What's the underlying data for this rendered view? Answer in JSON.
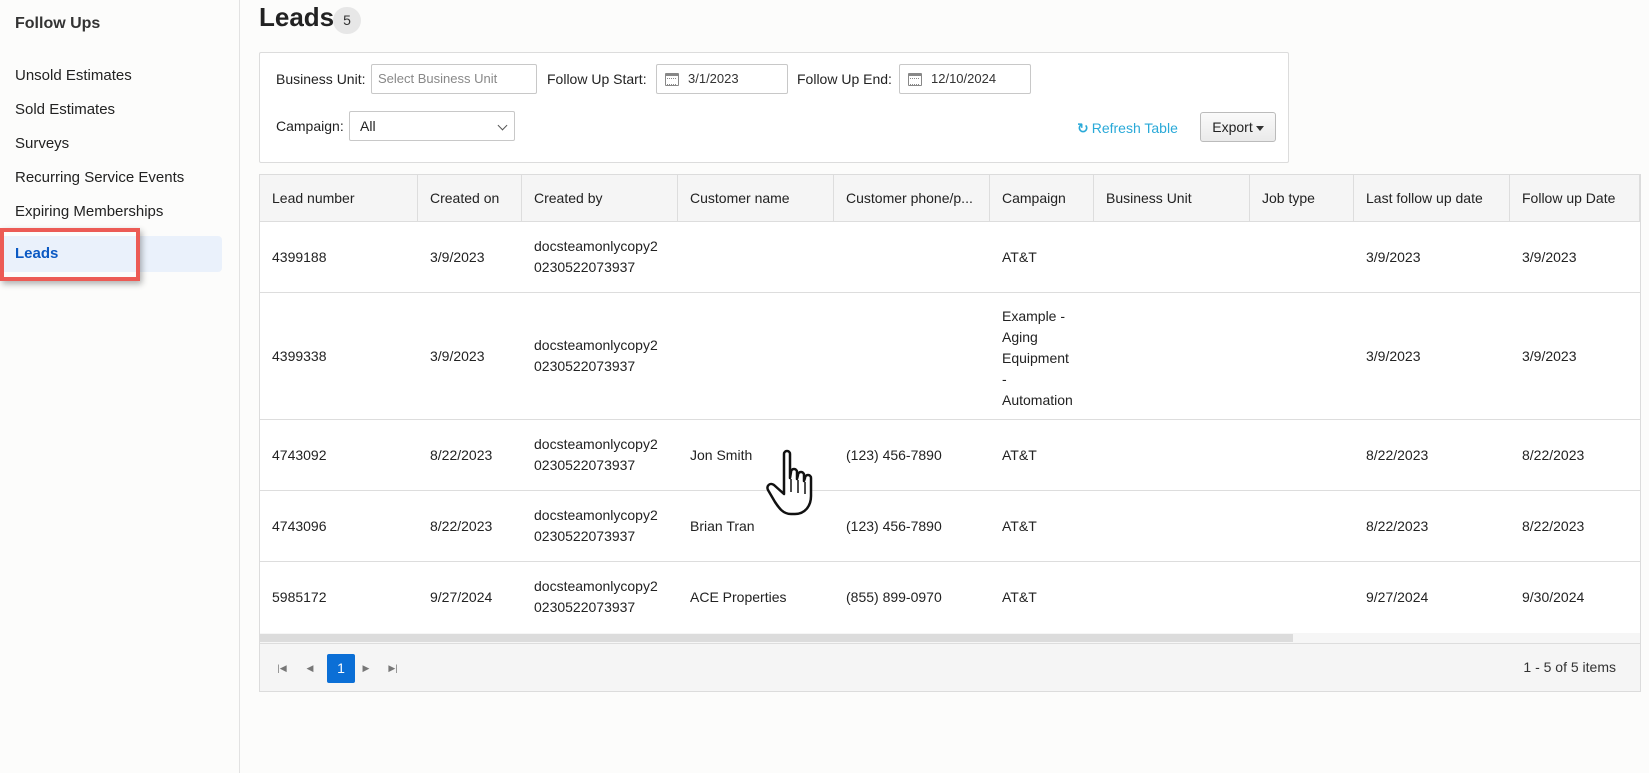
{
  "sidebar": {
    "title": "Follow Ups",
    "items": [
      {
        "label": "Unsold Estimates"
      },
      {
        "label": "Sold Estimates"
      },
      {
        "label": "Surveys"
      },
      {
        "label": "Recurring Service Events"
      },
      {
        "label": "Expiring Memberships"
      },
      {
        "label": "Leads",
        "active": true
      }
    ]
  },
  "page": {
    "title": "Leads",
    "count": "5"
  },
  "filters": {
    "business_unit_label": "Business Unit:",
    "business_unit_placeholder": "Select Business Unit",
    "follow_up_start_label": "Follow Up Start:",
    "follow_up_start_value": "3/1/2023",
    "follow_up_end_label": "Follow Up End:",
    "follow_up_end_value": "12/10/2024",
    "campaign_label": "Campaign:",
    "campaign_value": "All",
    "refresh_label": "Refresh Table",
    "export_label": "Export"
  },
  "table": {
    "columns": [
      "Lead number",
      "Created on",
      "Created by",
      "Customer name",
      "Customer phone/p...",
      "Campaign",
      "Business Unit",
      "Job type",
      "Last follow up date",
      "Follow up Date"
    ],
    "rows": [
      {
        "lead": "4399188",
        "created_on": "3/9/2023",
        "created_by_1": "docsteamonlycopy2",
        "created_by_2": "0230522073937",
        "customer": "",
        "phone": "",
        "campaign": [
          "AT&T"
        ],
        "bu": "",
        "job": "",
        "last": "3/9/2023",
        "follow": "3/9/2023"
      },
      {
        "lead": "4399338",
        "created_on": "3/9/2023",
        "created_by_1": "docsteamonlycopy2",
        "created_by_2": "0230522073937",
        "customer": "",
        "phone": "",
        "campaign": [
          "Example -",
          "Aging",
          "Equipment",
          "-",
          "Automation"
        ],
        "bu": "",
        "job": "",
        "last": "3/9/2023",
        "follow": "3/9/2023"
      },
      {
        "lead": "4743092",
        "created_on": "8/22/2023",
        "created_by_1": "docsteamonlycopy2",
        "created_by_2": "0230522073937",
        "customer": "Jon Smith",
        "phone": "(123) 456-7890",
        "campaign": [
          "AT&T"
        ],
        "bu": "",
        "job": "",
        "last": "8/22/2023",
        "follow": "8/22/2023"
      },
      {
        "lead": "4743096",
        "created_on": "8/22/2023",
        "created_by_1": "docsteamonlycopy2",
        "created_by_2": "0230522073937",
        "customer": "Brian Tran",
        "phone": "(123) 456-7890",
        "campaign": [
          "AT&T"
        ],
        "bu": "",
        "job": "",
        "last": "8/22/2023",
        "follow": "8/22/2023"
      },
      {
        "lead": "5985172",
        "created_on": "9/27/2024",
        "created_by_1": "docsteamonlycopy2",
        "created_by_2": "0230522073937",
        "customer": "ACE Properties",
        "phone": "(855) 899-0970",
        "campaign": [
          "AT&T"
        ],
        "bu": "",
        "job": "",
        "last": "9/27/2024",
        "follow": "9/30/2024"
      }
    ]
  },
  "pager": {
    "current_page": "1",
    "info": "1 - 5 of 5 items"
  },
  "colors": {
    "accent": "#0b6fd6",
    "active_nav_text": "#0b59c3",
    "highlight": "#ec5b55",
    "refresh": "#29a9d8"
  }
}
